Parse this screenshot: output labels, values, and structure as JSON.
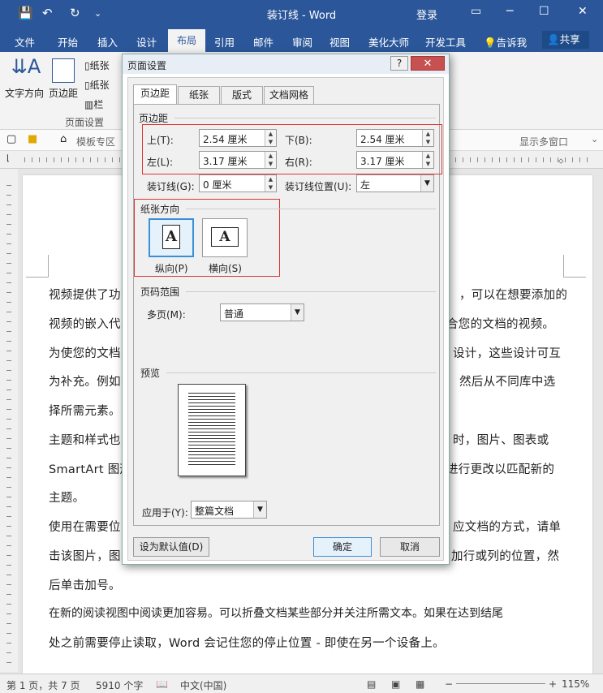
{
  "window": {
    "title": "装订线 - Word",
    "login": "登录"
  },
  "ribbon_tabs": [
    "文件",
    "开始",
    "插入",
    "设计",
    "布局",
    "引用",
    "邮件",
    "审阅",
    "视图",
    "美化大师",
    "开发工具",
    "告诉我",
    "共享"
  ],
  "ribbon": {
    "text_direction": "文字方向",
    "margins": "页边距",
    "size_label": "纸张",
    "columns_label": "栏",
    "group_label": "页面设置"
  },
  "navbar": {
    "template_zone": "模板专区",
    "show_multi_window": "显示多窗口"
  },
  "document": {
    "lines": [
      "视频提供了功",
      "，可以在想要添加的",
      "视频的嵌入代",
      "合您的文档的视频。",
      "为使您的文档",
      "设计，这些设计可互",
      "为补充。例如",
      "然后从不同库中选",
      "择所需元素。",
      "主题和样式也",
      "时，图片、图表或",
      "SmartArt 图形",
      "进行更改以匹配新的",
      "主题。",
      "使用在需要位",
      "应文档的方式，请单",
      "击该图片，图",
      "加行或列的位置，然",
      "后单击加号。",
      "在新的阅读视图中阅读更加容易。可以折叠文档某些部分并关注所需文本。如果在达到结尾",
      "处之前需要停止读取，Word 会记住您的停止位置 - 即使在另一个设备上。"
    ]
  },
  "status": {
    "page": "第 1 页，共 7 页",
    "words": "5910 个字",
    "lang": "中文(中国)",
    "zoom": "115%"
  },
  "dialog": {
    "title": "页面设置",
    "tabs": [
      "页边距",
      "纸张",
      "版式",
      "文档网格"
    ],
    "margins_group": "页边距",
    "top_label": "上(T):",
    "top_value": "2.54 厘米",
    "bottom_label": "下(B):",
    "bottom_value": "2.54 厘米",
    "left_label": "左(L):",
    "left_value": "3.17 厘米",
    "right_label": "右(R):",
    "right_value": "3.17 厘米",
    "gutter_label": "装订线(G):",
    "gutter_value": "0 厘米",
    "gutter_pos_label": "装订线位置(U):",
    "gutter_pos_value": "左",
    "orientation_group": "纸张方向",
    "portrait": "纵向(P)",
    "landscape": "横向(S)",
    "pages_group": "页码范围",
    "multi_pages_label": "多页(M):",
    "multi_pages_value": "普通",
    "preview_group": "预览",
    "apply_to_label": "应用于(Y):",
    "apply_to_value": "整篇文档",
    "set_default": "设为默认值(D)",
    "ok": "确定",
    "cancel": "取消"
  }
}
